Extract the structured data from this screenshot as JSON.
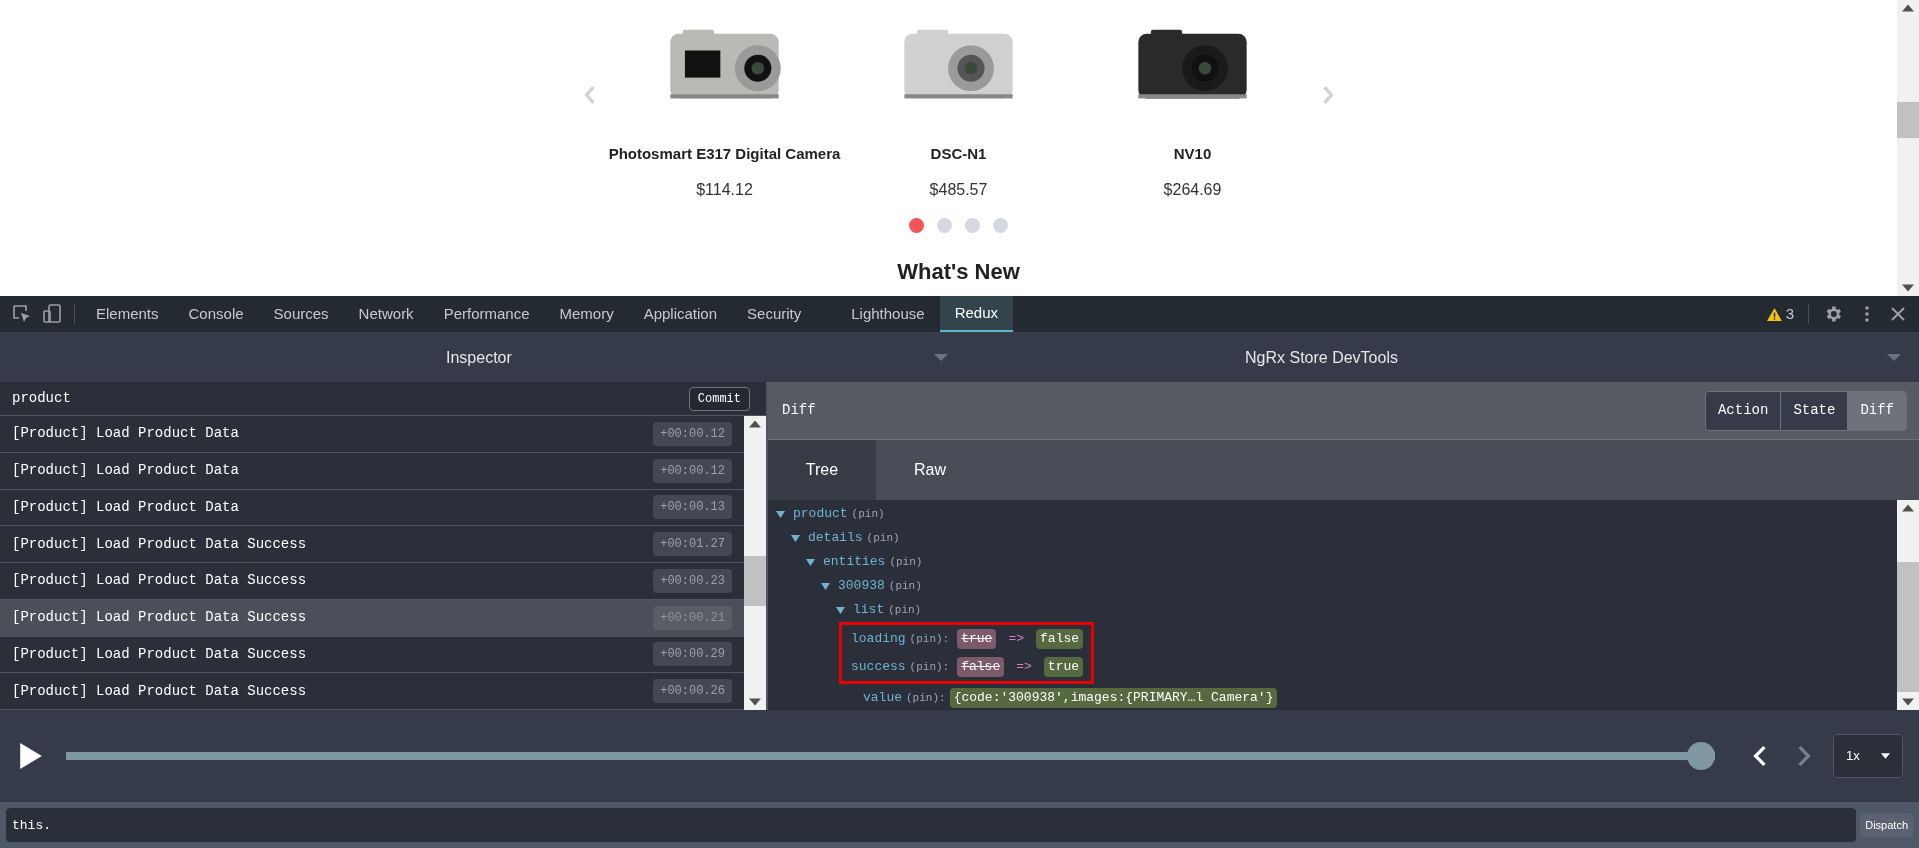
{
  "page": {
    "products": [
      {
        "name": "Photosmart E317 Digital Camera",
        "price": "$114.12",
        "kind": "picture"
      },
      {
        "name": "DSC-N1",
        "price": "$485.57",
        "kind": "picture"
      },
      {
        "name": "NV10",
        "price": "$264.69",
        "kind": "picture"
      }
    ],
    "dots": [
      {
        "selected": true
      },
      {
        "selected": false
      },
      {
        "selected": false
      },
      {
        "selected": false
      }
    ],
    "heading": "What's New"
  },
  "devtools": {
    "tabs": [
      {
        "label": "Elements",
        "selected": false
      },
      {
        "label": "Console",
        "selected": false
      },
      {
        "label": "Sources",
        "selected": false
      },
      {
        "label": "Network",
        "selected": false
      },
      {
        "label": "Performance",
        "selected": false
      },
      {
        "label": "Memory",
        "selected": false
      },
      {
        "label": "Application",
        "selected": false
      },
      {
        "label": "Security",
        "selected": false
      },
      {
        "label": "Lighthouse",
        "selected": false
      },
      {
        "label": "Redux",
        "selected": true
      }
    ],
    "warnings": "3"
  },
  "inspector": {
    "left_title": "Inspector",
    "right_title": "NgRx Store DevTools",
    "filter": {
      "value": "product"
    },
    "commit": "Commit",
    "actions": [
      {
        "label": "[Product] Load Product Data",
        "time": "+00:00.12",
        "selected": false
      },
      {
        "label": "[Product] Load Product Data",
        "time": "+00:00.12",
        "selected": false
      },
      {
        "label": "[Product] Load Product Data",
        "time": "+00:00.13",
        "selected": false
      },
      {
        "label": "[Product] Load Product Data Success",
        "time": "+00:01.27",
        "selected": false
      },
      {
        "label": "[Product] Load Product Data Success",
        "time": "+00:00.23",
        "selected": false
      },
      {
        "label": "[Product] Load Product Data Success",
        "time": "+00:00.21",
        "selected": true
      },
      {
        "label": "[Product] Load Product Data Success",
        "time": "+00:00.29",
        "selected": false
      },
      {
        "label": "[Product] Load Product Data Success",
        "time": "+00:00.26",
        "selected": false
      }
    ],
    "panel_title": "Diff",
    "modes": [
      {
        "label": "Action",
        "selected": false
      },
      {
        "label": "State",
        "selected": false
      },
      {
        "label": "Diff",
        "selected": true
      }
    ],
    "view_tabs": [
      {
        "label": "Tree",
        "selected": true
      },
      {
        "label": "Raw",
        "selected": false
      }
    ],
    "tree": [
      {
        "key": "product",
        "pin": "(pin)",
        "expanded": true,
        "children": [
          {
            "key": "details",
            "pin": "(pin)",
            "expanded": true,
            "children": [
              {
                "key": "entities",
                "pin": "(pin)",
                "expanded": true,
                "children": [
                  {
                    "key": "300938",
                    "pin": "(pin)",
                    "expanded": true,
                    "children": [
                      {
                        "key": "list",
                        "pin": "(pin)",
                        "expanded": true,
                        "children": [
                          {
                            "key": "loading",
                            "pin": "(pin):",
                            "old": "true",
                            "arrow": "=>",
                            "new": "false",
                            "highlighted": true
                          },
                          {
                            "key": "success",
                            "pin": "(pin):",
                            "old": "false",
                            "arrow": "=>",
                            "new": "true",
                            "highlighted": true
                          },
                          {
                            "key": "value",
                            "pin": "(pin):",
                            "new": "{code:'300938',images:{PRIMARY…l Camera'}",
                            "highlighted": false
                          }
                        ]
                      }
                    ]
                  }
                ]
              }
            ]
          }
        ]
      }
    ]
  },
  "player": {
    "level": 1,
    "speed": "1x",
    "next_disabled": true
  },
  "dispatch": {
    "value": "this.",
    "button": "Dispatch"
  }
}
